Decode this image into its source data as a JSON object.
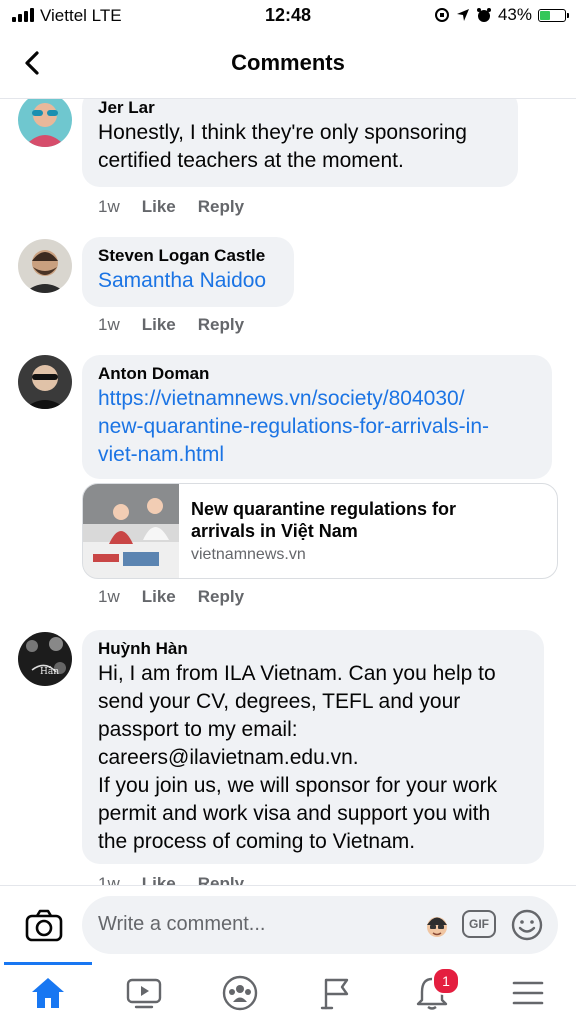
{
  "status_bar": {
    "carrier": "Viettel  LTE",
    "time": "12:48",
    "battery": "43%"
  },
  "header": {
    "title": "Comments"
  },
  "comments": [
    {
      "author": "Jer Lar",
      "text": "Honestly, I think they're only sponsoring\ncertified teachers at the moment.",
      "time": "1w",
      "like": "Like",
      "reply": "Reply"
    },
    {
      "author": "Steven Logan Castle",
      "mention": "Samantha Naidoo",
      "time": "1w",
      "like": "Like",
      "reply": "Reply"
    },
    {
      "author": "Anton Doman",
      "link": "https://vietnamnews.vn/society/804030/\nnew-quarantine-regulations-for-arrivals-in-\nviet-nam.html",
      "preview_title": "New quarantine regulations for\narrivals in Việt Nam",
      "preview_domain": "vietnamnews.vn",
      "time": "1w",
      "like": "Like",
      "reply": "Reply"
    },
    {
      "author": "Huỳnh Hàn",
      "text": "Hi, I am from ILA Vietnam. Can you help to\nsend your CV, degrees, TEFL and your\npassport to my email:\ncareers@ilavietnam.edu.vn.\nIf you join us, we will sponsor for your work\npermit and work visa and support you with\nthe process of coming to Vietnam.",
      "time": "1w",
      "like": "Like",
      "reply": "Reply"
    }
  ],
  "composer": {
    "placeholder": "Write a comment...",
    "gif_label": "GIF"
  },
  "tabbar": {
    "notifications_badge": "1"
  },
  "colors": {
    "accent": "#1877f2",
    "link": "#1b74e4",
    "bubble": "#f0f2f5",
    "badge": "#e41e3f"
  }
}
